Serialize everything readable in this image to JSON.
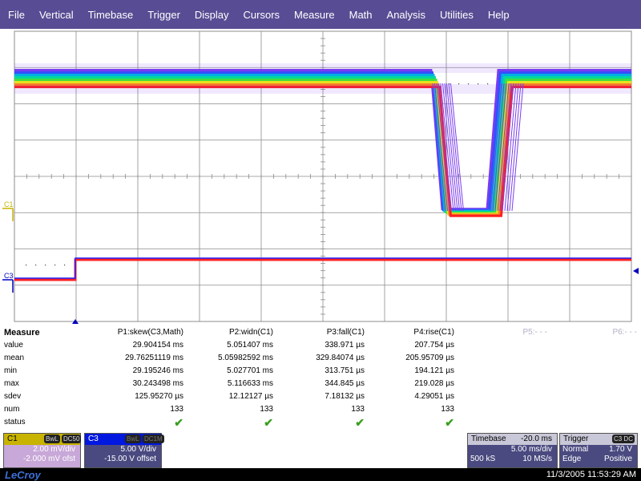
{
  "menu": [
    "File",
    "Vertical",
    "Timebase",
    "Trigger",
    "Display",
    "Cursors",
    "Measure",
    "Math",
    "Analysis",
    "Utilities",
    "Help"
  ],
  "scope": {
    "c1_label": "C1",
    "c3_label": "C3",
    "colors": {
      "c1": "#c8b400",
      "c3": "#0000c0",
      "grid": "#8c8c8c",
      "persist_outer": "#7a3cf0",
      "persist_inner": "#00d0d0",
      "trace_red": "#ff2020",
      "trace_blue": "#2020ff"
    }
  },
  "measure": {
    "header": "Measure",
    "row_labels": [
      "value",
      "mean",
      "min",
      "max",
      "sdev",
      "num",
      "status"
    ],
    "columns": [
      {
        "title": "P1:skew(C3,Math)",
        "values": [
          "29.904154 ms",
          "29.76251119 ms",
          "29.195246 ms",
          "30.243498 ms",
          "125.95270 µs",
          "133"
        ]
      },
      {
        "title": "P2:widn(C1)",
        "values": [
          "5.051407 ms",
          "5.05982592 ms",
          "5.027701 ms",
          "5.116633 ms",
          "12.12127 µs",
          "133"
        ]
      },
      {
        "title": "P3:fall(C1)",
        "values": [
          "338.971 µs",
          "329.84074 µs",
          "313.751 µs",
          "344.845 µs",
          "7.18132 µs",
          "133"
        ]
      },
      {
        "title": "P4:rise(C1)",
        "values": [
          "207.754 µs",
          "205.95709 µs",
          "194.121 µs",
          "219.028 µs",
          "4.29051 µs",
          "133"
        ]
      }
    ],
    "p5": "P5:- - -",
    "p6": "P6:- - -",
    "status_mark": "✔"
  },
  "c1_desc": {
    "title": "C1",
    "badge1": "BwL",
    "badge2": "DC50",
    "line1": "2.00 mV/div",
    "line2": "-2.000 mV ofst"
  },
  "c3_desc": {
    "title": "C3",
    "badge1": "BwL",
    "badge2": "DC1M",
    "line1": "5.00 V/div",
    "line2": "-15.00 V offset"
  },
  "timebase": {
    "title": "Timebase",
    "delay": "-20.0 ms",
    "rate": "5.00 ms/div",
    "samples": "500 kS",
    "srate": "10 MS/s"
  },
  "trigger": {
    "title": "Trigger",
    "badge": "C3 DC",
    "mode": "Normal",
    "level": "1.70 V",
    "type": "Edge",
    "slope": "Positive"
  },
  "footer": {
    "brand": "LeCroy",
    "timestamp": "11/3/2005 11:53:29 AM"
  }
}
